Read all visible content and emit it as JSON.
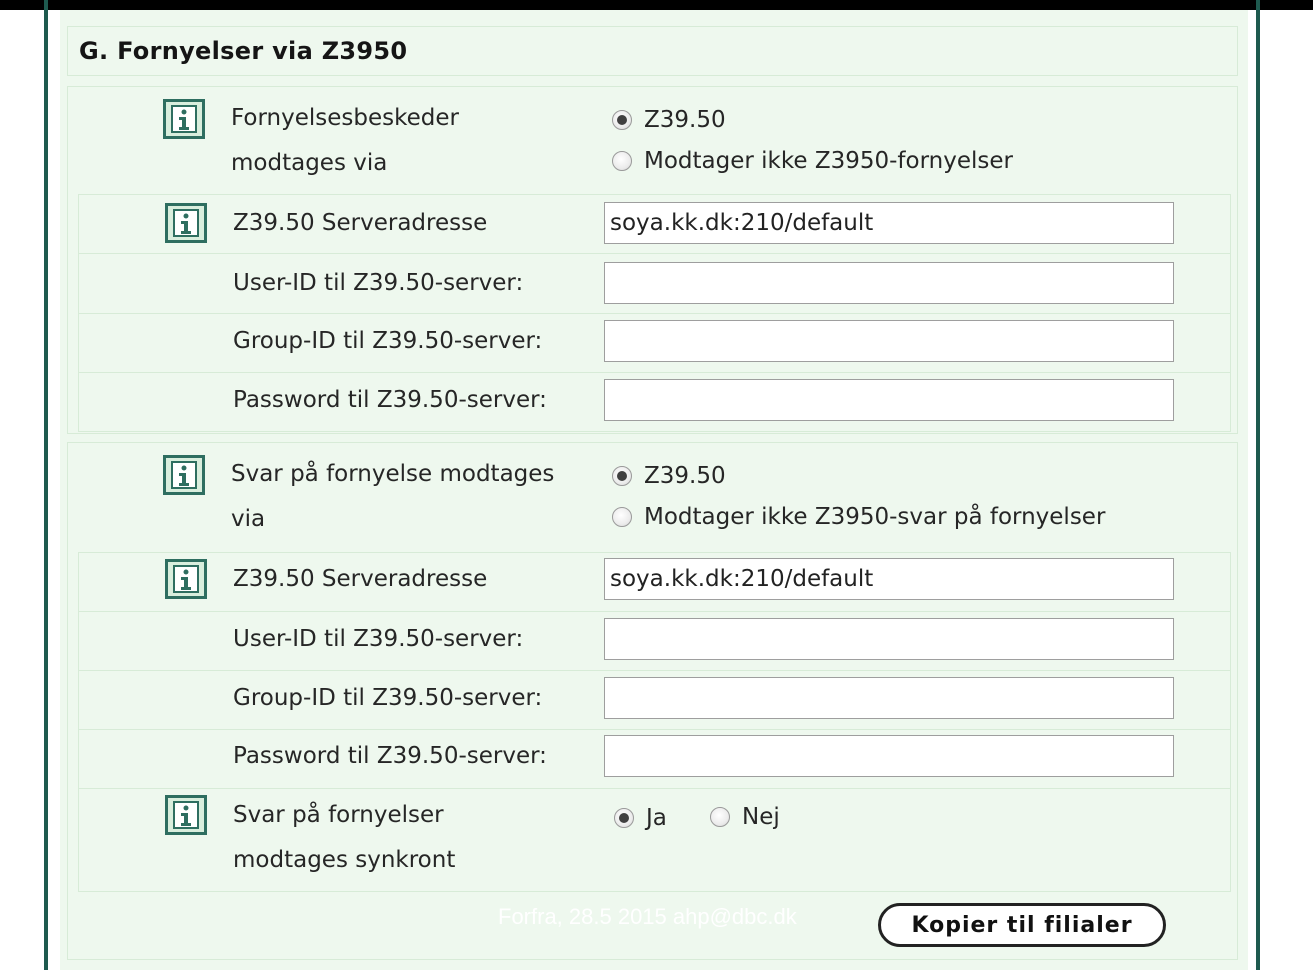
{
  "section": {
    "title": "G. Fornyelser via Z3950"
  },
  "renewal_requests": {
    "label": "Fornyelsesbeskeder modtages via",
    "label_line1": "Fornyelsesbeskeder",
    "label_line2": "modtages via",
    "options": [
      {
        "label": "Z39.50",
        "checked": true
      },
      {
        "label": "Modtager ikke Z3950-fornyelser",
        "checked": false
      }
    ],
    "server_address": {
      "label": "Z39.50 Serveradresse",
      "value": "soya.kk.dk:210/default"
    },
    "user_id": {
      "label": "User-ID til Z39.50-server:",
      "value": ""
    },
    "group_id": {
      "label": "Group-ID til Z39.50-server:",
      "value": ""
    },
    "password": {
      "label": "Password til Z39.50-server:",
      "value": ""
    }
  },
  "renewal_answers": {
    "label_line1": "Svar på fornyelse modtages",
    "label_line2": "via",
    "options": [
      {
        "label": "Z39.50",
        "checked": true
      },
      {
        "label": "Modtager ikke Z3950-svar på fornyelser",
        "checked": false
      }
    ],
    "server_address": {
      "label": "Z39.50 Serveradresse",
      "value": "soya.kk.dk:210/default"
    },
    "user_id": {
      "label": "User-ID til Z39.50-server:",
      "value": ""
    },
    "group_id": {
      "label": "Group-ID til Z39.50-server:",
      "value": ""
    },
    "password": {
      "label": "Password til Z39.50-server:",
      "value": ""
    }
  },
  "synchronous": {
    "label_line1": "Svar på fornyelser",
    "label_line2": "modtages synkront",
    "options": [
      {
        "label": "Ja",
        "checked": true
      },
      {
        "label": "Nej",
        "checked": false
      }
    ]
  },
  "footer": {
    "text": "Forfra, 28.5 2015 ahp@dbc.dk"
  },
  "actions": {
    "copy_button": "Kopier til filialer"
  },
  "colors": {
    "frame": "#1e5a4f",
    "panel": "#eef8ee",
    "cell_border": "#d7ebd7",
    "info_border": "#2e6e60"
  }
}
